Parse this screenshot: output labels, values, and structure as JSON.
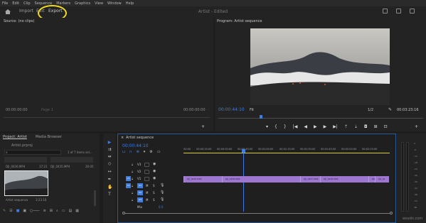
{
  "menu": [
    "File",
    "Edit",
    "Clip",
    "Sequence",
    "Markers",
    "Graphics",
    "View",
    "Window",
    "Help"
  ],
  "header": {
    "tabs": [
      "Import",
      "Edit",
      "Export"
    ],
    "title": "Artist - Edited",
    "accent": "#f2dc1e"
  },
  "source": {
    "tab": "Source: (no clips)",
    "tc_left": "00:00:00:00",
    "tc_right": "00:00:00:00",
    "page": "Page 1"
  },
  "program": {
    "tab": "Program: Artist sequence",
    "tc_current": "00:00:44:10",
    "fit": "Fit",
    "scale": "1/2",
    "tc_duration": "00:03:23:16"
  },
  "project": {
    "tabs": [
      "Project: Artist",
      "Media Browser"
    ],
    "file": "Artist.prproj",
    "count": "1 of 7 items sel...",
    "items": [
      {
        "name": "DJI_0436.MP4",
        "dur": "17:21"
      },
      {
        "name": "DJI_0435.MP4",
        "dur": "26:05"
      },
      {
        "name": "Artist sequence",
        "dur": "3:23:16"
      }
    ]
  },
  "timeline": {
    "tab": "Artist sequence",
    "tc": "00:00:44:10",
    "ruler": [
      "00:00",
      "00:00:15:00",
      "00:00:30:00",
      "00:00:45:00",
      "00:01:00:00",
      "00:01:15:00",
      "00:01:30:00",
      "00:01:45:00",
      "00:02:00:00",
      "00:02:15:00"
    ],
    "video_tracks": [
      "V3",
      "V2",
      "V1"
    ],
    "audio_tracks": [
      "A1",
      "A2",
      "A3"
    ],
    "mix": "Mix",
    "mix_val": "0.0",
    "clips": [
      {
        "label": "DJI_0429.MP4"
      },
      {
        "label": "DJI_0436.MP4"
      },
      {
        "label": "DJI_0427.MP4"
      },
      {
        "label": "DJI_0438.MP4"
      },
      {
        "label": "DJI_0437.MP4"
      },
      {
        "label": "DJI_04"
      }
    ]
  },
  "meter": [
    "0",
    "-6",
    "-12",
    "-18",
    "-24",
    "-30",
    "-36",
    "-42",
    "-48",
    "-54",
    "dB"
  ],
  "watermark": "wsxdn.com",
  "colors": {
    "accent_blue": "#3f7de0",
    "clip_purple": "#9c76cf"
  }
}
